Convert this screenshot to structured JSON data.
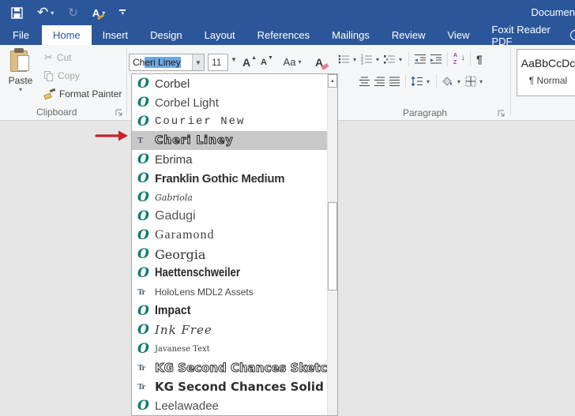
{
  "colors": {
    "titlebar_blue": "#2b579a",
    "ribbon_bg": "#f5f6f7",
    "selected_row_gray": "#c8c8c8",
    "arrow_red": "#cc2128",
    "opentype_icon_teal": "#0a7d6c"
  },
  "title_bar": {
    "title": "Documen"
  },
  "tabs": [
    {
      "label": "File"
    },
    {
      "label": "Home"
    },
    {
      "label": "Insert"
    },
    {
      "label": "Design"
    },
    {
      "label": "Layout"
    },
    {
      "label": "References"
    },
    {
      "label": "Mailings"
    },
    {
      "label": "Review"
    },
    {
      "label": "View"
    },
    {
      "label": "Foxit Reader PDF"
    }
  ],
  "ribbon": {
    "clipboard": {
      "paste_label": "Paste",
      "cut_label": "Cut",
      "copy_label": "Copy",
      "format_painter_label": "Format Painter",
      "group_label": "Clipboard"
    },
    "font": {
      "font_name_unselected": "Ch",
      "font_name_selected": "eri Liney",
      "font_size": "11",
      "grow_font_label": "A",
      "shrink_font_label": "A",
      "change_case_label": "Aa",
      "clear_format_label": "A"
    },
    "paragraph": {
      "group_label": "Paragraph",
      "pilcrow": "¶",
      "sort_a": "A",
      "sort_z": "Z",
      "sort_arrow": "↓"
    },
    "styles": {
      "style_preview": "AaBbCcDc",
      "style_name": "¶ Normal"
    }
  },
  "qat": {
    "undo_glyph": "↶",
    "redo_glyph": "↻",
    "pen_glyph": "A"
  },
  "font_dropdown": {
    "items": [
      {
        "icon": "O",
        "name": "Corbel"
      },
      {
        "icon": "O",
        "name": "Corbel Light"
      },
      {
        "icon": "O",
        "name": "Courier New"
      },
      {
        "icon": "T",
        "name": "Cheri Liney",
        "selected": true
      },
      {
        "icon": "O",
        "name": "Ebrima"
      },
      {
        "icon": "O",
        "name": "Franklin Gothic Medium"
      },
      {
        "icon": "O",
        "name": "Gabriola"
      },
      {
        "icon": "O",
        "name": "Gadugi"
      },
      {
        "icon": "O",
        "name": "Garamond"
      },
      {
        "icon": "O",
        "name": "Georgia"
      },
      {
        "icon": "O",
        "name": "Haettenschweiler"
      },
      {
        "icon": "Tr",
        "name": "HoloLens MDL2 Assets"
      },
      {
        "icon": "O",
        "name": "Impact"
      },
      {
        "icon": "O",
        "name": "Ink Free"
      },
      {
        "icon": "O",
        "name": "Javanese Text"
      },
      {
        "icon": "Tr",
        "name": "KG Second Chances Sketch"
      },
      {
        "icon": "Tr",
        "name": "KG Second Chances Solid"
      },
      {
        "icon": "O",
        "name": "Leelawadee"
      }
    ]
  }
}
